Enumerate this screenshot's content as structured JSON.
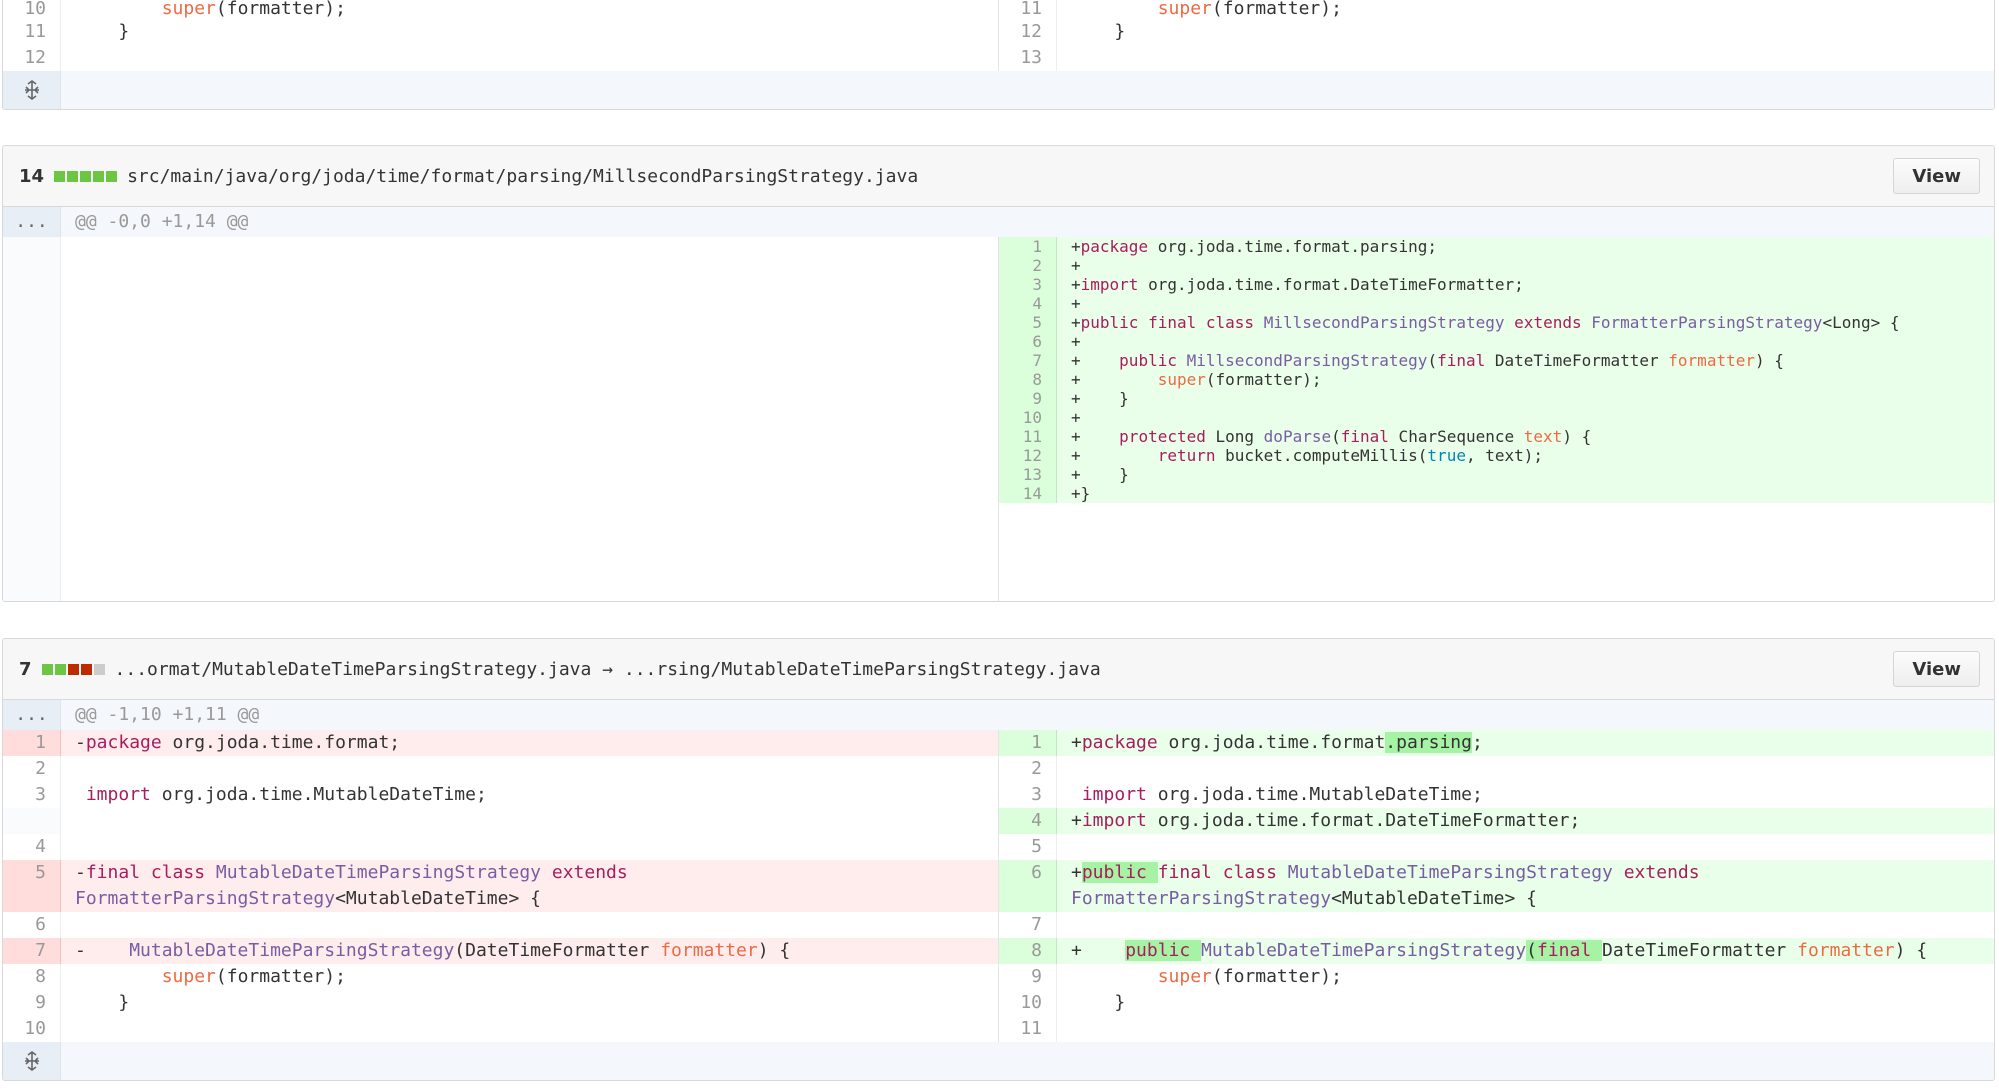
{
  "colors": {
    "keyword": "#a71d5d",
    "entity": "#795da3",
    "variable": "#ed6a43",
    "constant": "#0086b3",
    "addition_bg": "#eaffea",
    "deletion_bg": "#ffecec",
    "diffstat_add": "#6cc644",
    "diffstat_del": "#bd2c00",
    "diffstat_neutral": "#cccccc"
  },
  "top_fragment": {
    "left_nums": [
      "10",
      "11",
      "12"
    ],
    "right_nums": [
      "11",
      "12",
      "13"
    ],
    "expand_icon": "unfold-icon"
  },
  "file1": {
    "count": "14",
    "path": "src/main/java/org/joda/time/format/parsing/MillsecondParsingStrategy.java",
    "view_label": "View",
    "hunk_dots": "...",
    "hunk_header": "@@ -0,0 +1,14 @@",
    "nums": [
      "1",
      "2",
      "3",
      "4",
      "5",
      "6",
      "7",
      "8",
      "9",
      "10",
      "11",
      "12",
      "13",
      "14"
    ]
  },
  "file2": {
    "count": "7",
    "path": "...ormat/MutableDateTimeParsingStrategy.java → ...rsing/MutableDateTimeParsingStrategy.java",
    "view_label": "View",
    "hunk_dots": "...",
    "hunk_header": "@@ -1,10 +1,11 @@",
    "left_nums": [
      "1",
      "2",
      "3",
      "4",
      "5",
      "6",
      "7",
      "8",
      "9",
      "10"
    ],
    "right_nums": [
      "1",
      "2",
      "3",
      "4",
      "5",
      "6",
      "7",
      "8",
      "9",
      "10",
      "11"
    ],
    "expand_icon": "unfold-icon"
  }
}
